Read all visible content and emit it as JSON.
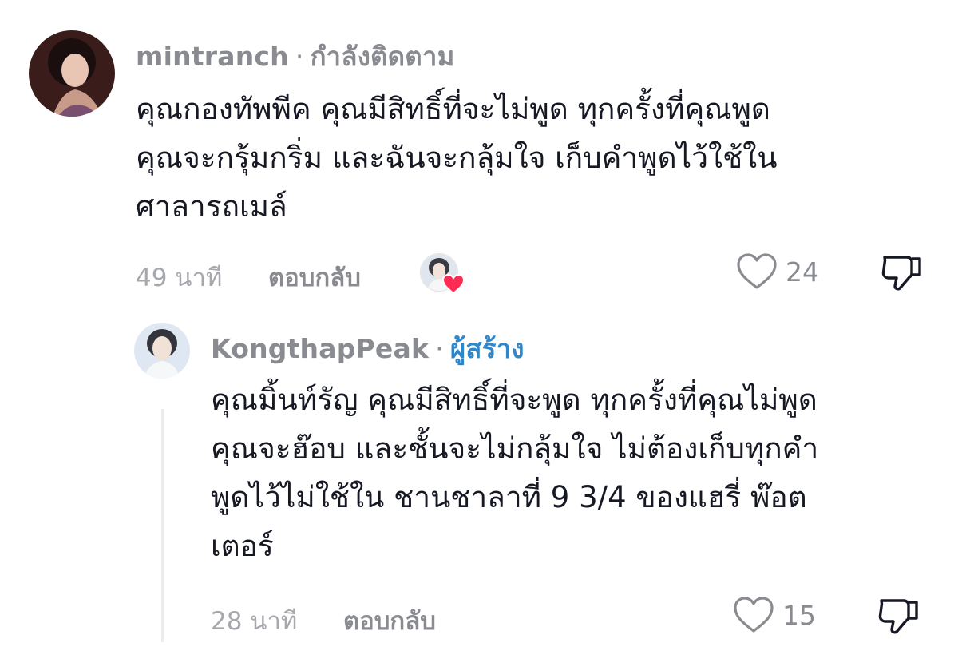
{
  "comment": {
    "username": "mintranch",
    "separator": "·",
    "status": "กำลังติดตาม",
    "text": "คุณกองทัพพีค คุณมีสิทธิ์ที่จะไม่พูด ทุกครั้งที่คุณพูด\nคุณจะกรุ้มกริ่ม และฉันจะกลุ้มใจ เก็บคำพูดไว้ใช้ใน\nศาลารถเมล์",
    "time": "49 นาที",
    "reply_label": "ตอบกลับ",
    "likes": "24"
  },
  "reply": {
    "username": "KongthapPeak",
    "separator": "·",
    "badge": "ผู้สร้าง",
    "text": "คุณมิ้นท์รัญ คุณมีสิทธิ์ที่จะพูด ทุกครั้งที่คุณไม่พูด\nคุณจะฮ๊อบ และชั้นจะไม่กลุ้มใจ ไม่ต้องเก็บทุกคำ\nพูดไว้ไม่ใช้ใน ชานชาลาที่ 9 3/4 ของแฮรี่ พ๊อต\nเตอร์",
    "time": "28 นาที",
    "reply_label": "ตอบกลับ",
    "likes": "15"
  },
  "colors": {
    "username": "#8a8b91",
    "creator_badge": "#2f86c8",
    "heart_badge": "#fe2c55",
    "text": "#161823"
  },
  "icons": [
    "heart-outline-icon",
    "thumbs-down-icon",
    "heart-filled-icon"
  ]
}
